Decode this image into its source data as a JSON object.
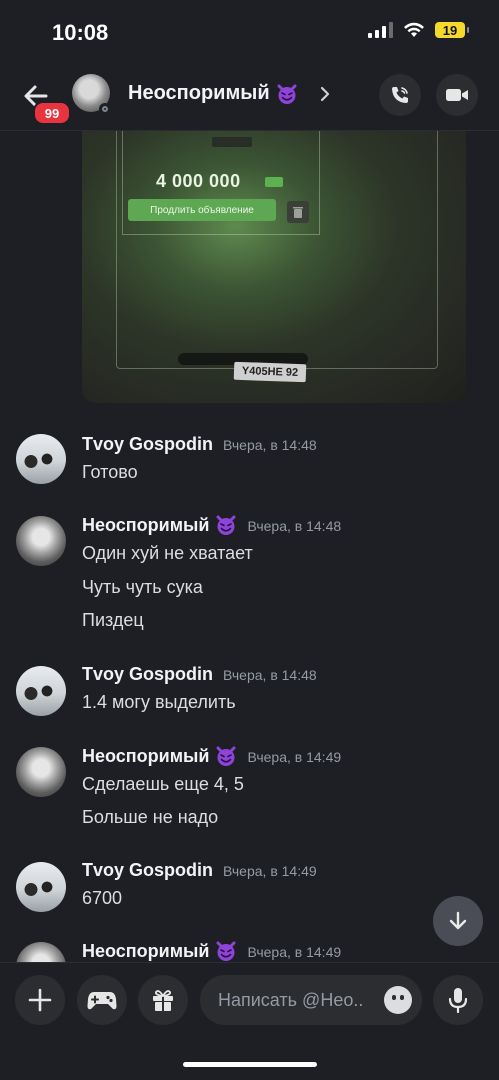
{
  "status_bar": {
    "time": "10:08",
    "battery": "19"
  },
  "header": {
    "badge": "99",
    "title": "Неоспоримый",
    "title_emoji": "smiling-imp-icon"
  },
  "attachment": {
    "price": "4 000 000",
    "button_label": "Продлить объявление",
    "plate": "Y405HE 92"
  },
  "messages": [
    {
      "author": "Tvoy Gospodin",
      "emoji": "",
      "timestamp": "Вчера, в 14:48",
      "lines": [
        "Готово"
      ]
    },
    {
      "author": "Неоспоримый",
      "emoji": "smiling-imp-icon",
      "timestamp": "Вчера, в 14:48",
      "lines": [
        "Один хуй не хватает",
        "Чуть чуть сука",
        "Пиздец"
      ]
    },
    {
      "author": "Tvoy Gospodin",
      "emoji": "",
      "timestamp": "Вчера, в 14:48",
      "lines": [
        "1.4 могу выделить"
      ]
    },
    {
      "author": "Неоспоримый",
      "emoji": "smiling-imp-icon",
      "timestamp": "Вчера, в 14:49",
      "lines": [
        "Сделаешь еще 4, 5",
        "Больше не надо"
      ]
    },
    {
      "author": "Tvoy Gospodin",
      "emoji": "",
      "timestamp": "Вчера, в 14:49",
      "lines": [
        "6700"
      ]
    },
    {
      "author": "Неоспоримый",
      "emoji": "smiling-imp-icon",
      "timestamp": "Вчера, в 14:49",
      "lines": []
    }
  ],
  "composer": {
    "placeholder": "Написать @Нео.."
  },
  "colors": {
    "accent_badge": "#e8343e",
    "background": "#1e1f24",
    "button_bg": "#2b2d31",
    "emoji_purple": "#8e44d9"
  }
}
